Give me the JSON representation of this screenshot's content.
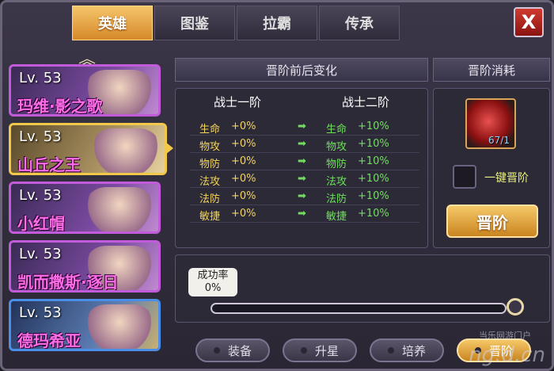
{
  "tabs": [
    {
      "label": "英雄",
      "active": true
    },
    {
      "label": "图鉴",
      "active": false
    },
    {
      "label": "拉霸",
      "active": false
    },
    {
      "label": "传承",
      "active": false
    }
  ],
  "close_label": "X",
  "heroes": [
    {
      "level": "Lv. 53",
      "name": "玛维·影之歌"
    },
    {
      "level": "Lv. 53",
      "name": "山丘之王"
    },
    {
      "level": "Lv. 53",
      "name": "小红帽"
    },
    {
      "level": "Lv. 53",
      "name": "凯而撒斯·逐日"
    },
    {
      "level": "Lv. 53",
      "name": "德玛希亚"
    }
  ],
  "headers": {
    "change": "晋阶前后变化",
    "cost": "晋阶消耗"
  },
  "stats": {
    "before_title": "战士一阶",
    "after_title": "战士二阶",
    "rows": [
      {
        "name": "生命",
        "before": "+0%",
        "after": "+10%"
      },
      {
        "name": "物攻",
        "before": "+0%",
        "after": "+10%"
      },
      {
        "name": "物防",
        "before": "+0%",
        "after": "+10%"
      },
      {
        "name": "法攻",
        "before": "+0%",
        "after": "+10%"
      },
      {
        "name": "法防",
        "before": "+0%",
        "after": "+10%"
      },
      {
        "name": "敏捷",
        "before": "+0%",
        "after": "+10%"
      }
    ]
  },
  "cost": {
    "gem_count": "67/1",
    "auto_label": "一键晋阶",
    "button_label": "晋阶"
  },
  "rate": {
    "label": "成功率",
    "value": "0%",
    "progress": 0
  },
  "bottom_buttons": [
    {
      "label": "装备",
      "active": false
    },
    {
      "label": "升星",
      "active": false
    },
    {
      "label": "培养",
      "active": false
    },
    {
      "label": "晋阶",
      "active": true
    }
  ],
  "watermark": {
    "main": "ng.d.cn",
    "sub": "当乐网游门户"
  }
}
